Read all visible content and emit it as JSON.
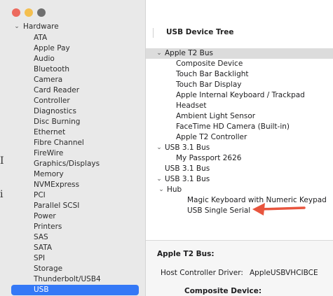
{
  "sidebar": {
    "header": "Hardware",
    "items": [
      "ATA",
      "Apple Pay",
      "Audio",
      "Bluetooth",
      "Camera",
      "Card Reader",
      "Controller",
      "Diagnostics",
      "Disc Burning",
      "Ethernet",
      "Fibre Channel",
      "FireWire",
      "Graphics/Displays",
      "Memory",
      "NVMExpress",
      "PCI",
      "Parallel SCSI",
      "Power",
      "Printers",
      "SAS",
      "SATA",
      "SPI",
      "Storage",
      "Thunderbolt/USB4",
      "USB"
    ],
    "selected": "USB",
    "artifact_top": "I",
    "artifact_mid": "i"
  },
  "main": {
    "tree_title": "USB Device Tree",
    "tree": [
      {
        "label": "Apple T2 Bus",
        "indent": 0,
        "chevron": "down",
        "selected": true
      },
      {
        "label": "Composite Device",
        "indent": 2
      },
      {
        "label": "Touch Bar Backlight",
        "indent": 2
      },
      {
        "label": "Touch Bar Display",
        "indent": 2
      },
      {
        "label": "Apple Internal Keyboard / Trackpad",
        "indent": 2
      },
      {
        "label": "Headset",
        "indent": 2
      },
      {
        "label": "Ambient Light Sensor",
        "indent": 2
      },
      {
        "label": "FaceTime HD Camera (Built-in)",
        "indent": 2
      },
      {
        "label": "Apple T2 Controller",
        "indent": 2
      },
      {
        "label": "USB 3.1 Bus",
        "indent": 0,
        "chevron": "down"
      },
      {
        "label": "My Passport 2626",
        "indent": 2
      },
      {
        "label": "USB 3.1 Bus",
        "indent": 0
      },
      {
        "label": "USB 3.1 Bus",
        "indent": 0,
        "chevron": "down"
      },
      {
        "label": "Hub",
        "indent": 1,
        "chevron": "down"
      },
      {
        "label": "Magic Keyboard with Numeric Keypad",
        "indent": 3
      },
      {
        "label": "USB Single Serial",
        "indent": 3
      }
    ],
    "detail": {
      "title": "Apple T2 Bus:",
      "host_label": "Host Controller Driver:",
      "host_value": "AppleUSBVHCIBCE",
      "sub_title": "Composite Device:"
    }
  },
  "colors": {
    "selection_blue": "#3478f6",
    "arrow": "#e8553e",
    "red": "#ec6a5e",
    "yellow": "#f4bf4f"
  }
}
